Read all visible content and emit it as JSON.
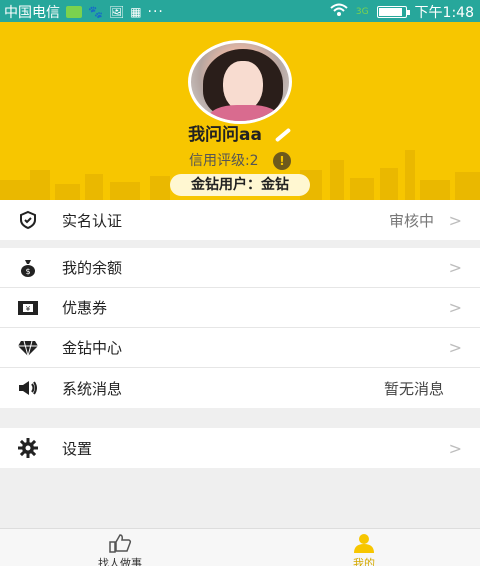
{
  "statusbar": {
    "carrier": "中国电信",
    "time": "下午1:48",
    "battery_level": 0.9,
    "signal_label": "3G"
  },
  "profile": {
    "nickname": "我问问aa",
    "credit_label": "信用评级:2",
    "credit_warn": "!",
    "vip_label": "金钻用户：金钻"
  },
  "menu": {
    "verification": {
      "label": "实名认证",
      "value": "审核中"
    },
    "balance": {
      "label": "我的余额"
    },
    "coupon": {
      "label": "优惠券"
    },
    "gold_center": {
      "label": "金钻中心"
    },
    "messages": {
      "label": "系统消息",
      "value": "暂无消息"
    },
    "settings": {
      "label": "设置"
    }
  },
  "nav": {
    "find_person": "找人做事",
    "mine": "我的"
  },
  "colors": {
    "statusbar": "#27a79b",
    "header": "#f7c600",
    "accent": "#d4a900"
  },
  "icons": {
    "verification": "shield-check-icon",
    "balance": "money-bag-icon",
    "coupon": "ticket-icon",
    "gold_center": "diamond-icon",
    "messages": "speaker-icon",
    "settings": "gear-icon",
    "find_person": "thumbs-up-icon",
    "mine": "person-icon"
  }
}
